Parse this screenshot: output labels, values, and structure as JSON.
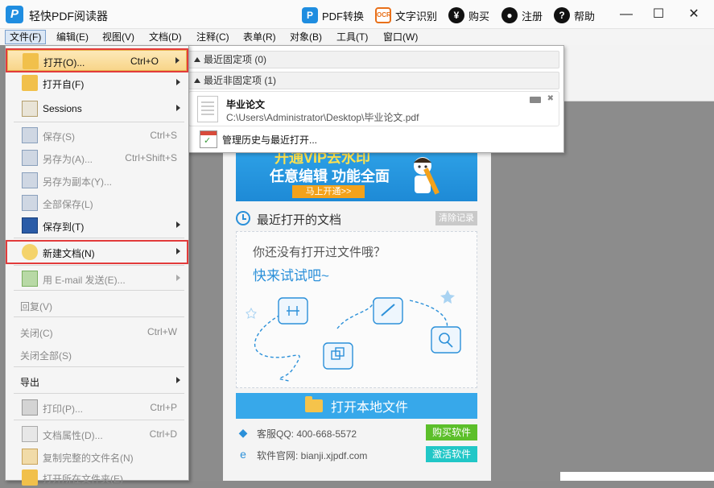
{
  "app": {
    "title": "轻快PDF阅读器",
    "logo_letter": "P"
  },
  "title_actions": [
    {
      "label": "PDF转换",
      "icon": "pdf-convert-icon",
      "glyph": "P"
    },
    {
      "label": "文字识别",
      "icon": "ocr-icon",
      "glyph": "OCR"
    },
    {
      "label": "购买",
      "icon": "yen-icon",
      "glyph": "¥"
    },
    {
      "label": "注册",
      "icon": "user-icon",
      "glyph": "●"
    },
    {
      "label": "帮助",
      "icon": "help-icon",
      "glyph": "?"
    }
  ],
  "window_controls": {
    "minimize": "—",
    "maximize": "☐",
    "close": "✕"
  },
  "menubar": [
    "文件(F)",
    "编辑(E)",
    "视图(V)",
    "文档(D)",
    "注释(C)",
    "表单(R)",
    "对象(B)",
    "工具(T)",
    "窗口(W)"
  ],
  "file_menu": {
    "open": {
      "label": "打开(O)...",
      "shortcut": "Ctrl+O"
    },
    "open_from": {
      "label": "打开自(F)"
    },
    "sessions": {
      "label": "Sessions"
    },
    "save": {
      "label": "保存(S)",
      "shortcut": "Ctrl+S"
    },
    "save_as": {
      "label": "另存为(A)...",
      "shortcut": "Ctrl+Shift+S"
    },
    "save_copy": {
      "label": "另存为副本(Y)..."
    },
    "save_all": {
      "label": "全部保存(L)"
    },
    "save_to": {
      "label": "保存到(T)"
    },
    "new_doc": {
      "label": "新建文档(N)"
    },
    "email": {
      "label": "用 E-mail 发送(E)..."
    },
    "revert": {
      "label": "回复(V)"
    },
    "close": {
      "label": "关闭(C)",
      "shortcut": "Ctrl+W"
    },
    "close_all": {
      "label": "关闭全部(S)"
    },
    "export": {
      "label": "导出"
    },
    "print": {
      "label": "打印(P)...",
      "shortcut": "Ctrl+P"
    },
    "doc_props": {
      "label": "文档属性(D)...",
      "shortcut": "Ctrl+D"
    },
    "copy_name": {
      "label": "复制完整的文件名(N)"
    },
    "open_folder": {
      "label": "打开所在文件夹(E)"
    }
  },
  "recent_flyout": {
    "pinned_header": "最近固定项 (0)",
    "unpinned_header": "最近非固定项 (1)",
    "files": [
      {
        "name": "毕业论文",
        "path": "C:\\Users\\Administrator\\Desktop\\毕业论文.pdf"
      }
    ],
    "manage": "管理历史与最近打开..."
  },
  "start_panel": {
    "banner_line1": "开通VIP去水印",
    "banner_line2": "任意编辑  功能全面",
    "banner_button": "马上开通>>",
    "recent_title": "最近打开的文档",
    "clear_label": "清除记录",
    "empty_line1": "你还没有打开过文件哦？",
    "empty_line2": "快来试试吧~",
    "open_local": "打开本地文件",
    "qq": "客服QQ: 400-668-5572",
    "website": "软件官网: bianji.xjpdf.com",
    "buy_button": "购买软件",
    "activate_button": "激活软件"
  },
  "colors": {
    "accent": "#2b90d9",
    "highlight_border": "#e23b3b",
    "menu_hover": "#f8d58a"
  }
}
